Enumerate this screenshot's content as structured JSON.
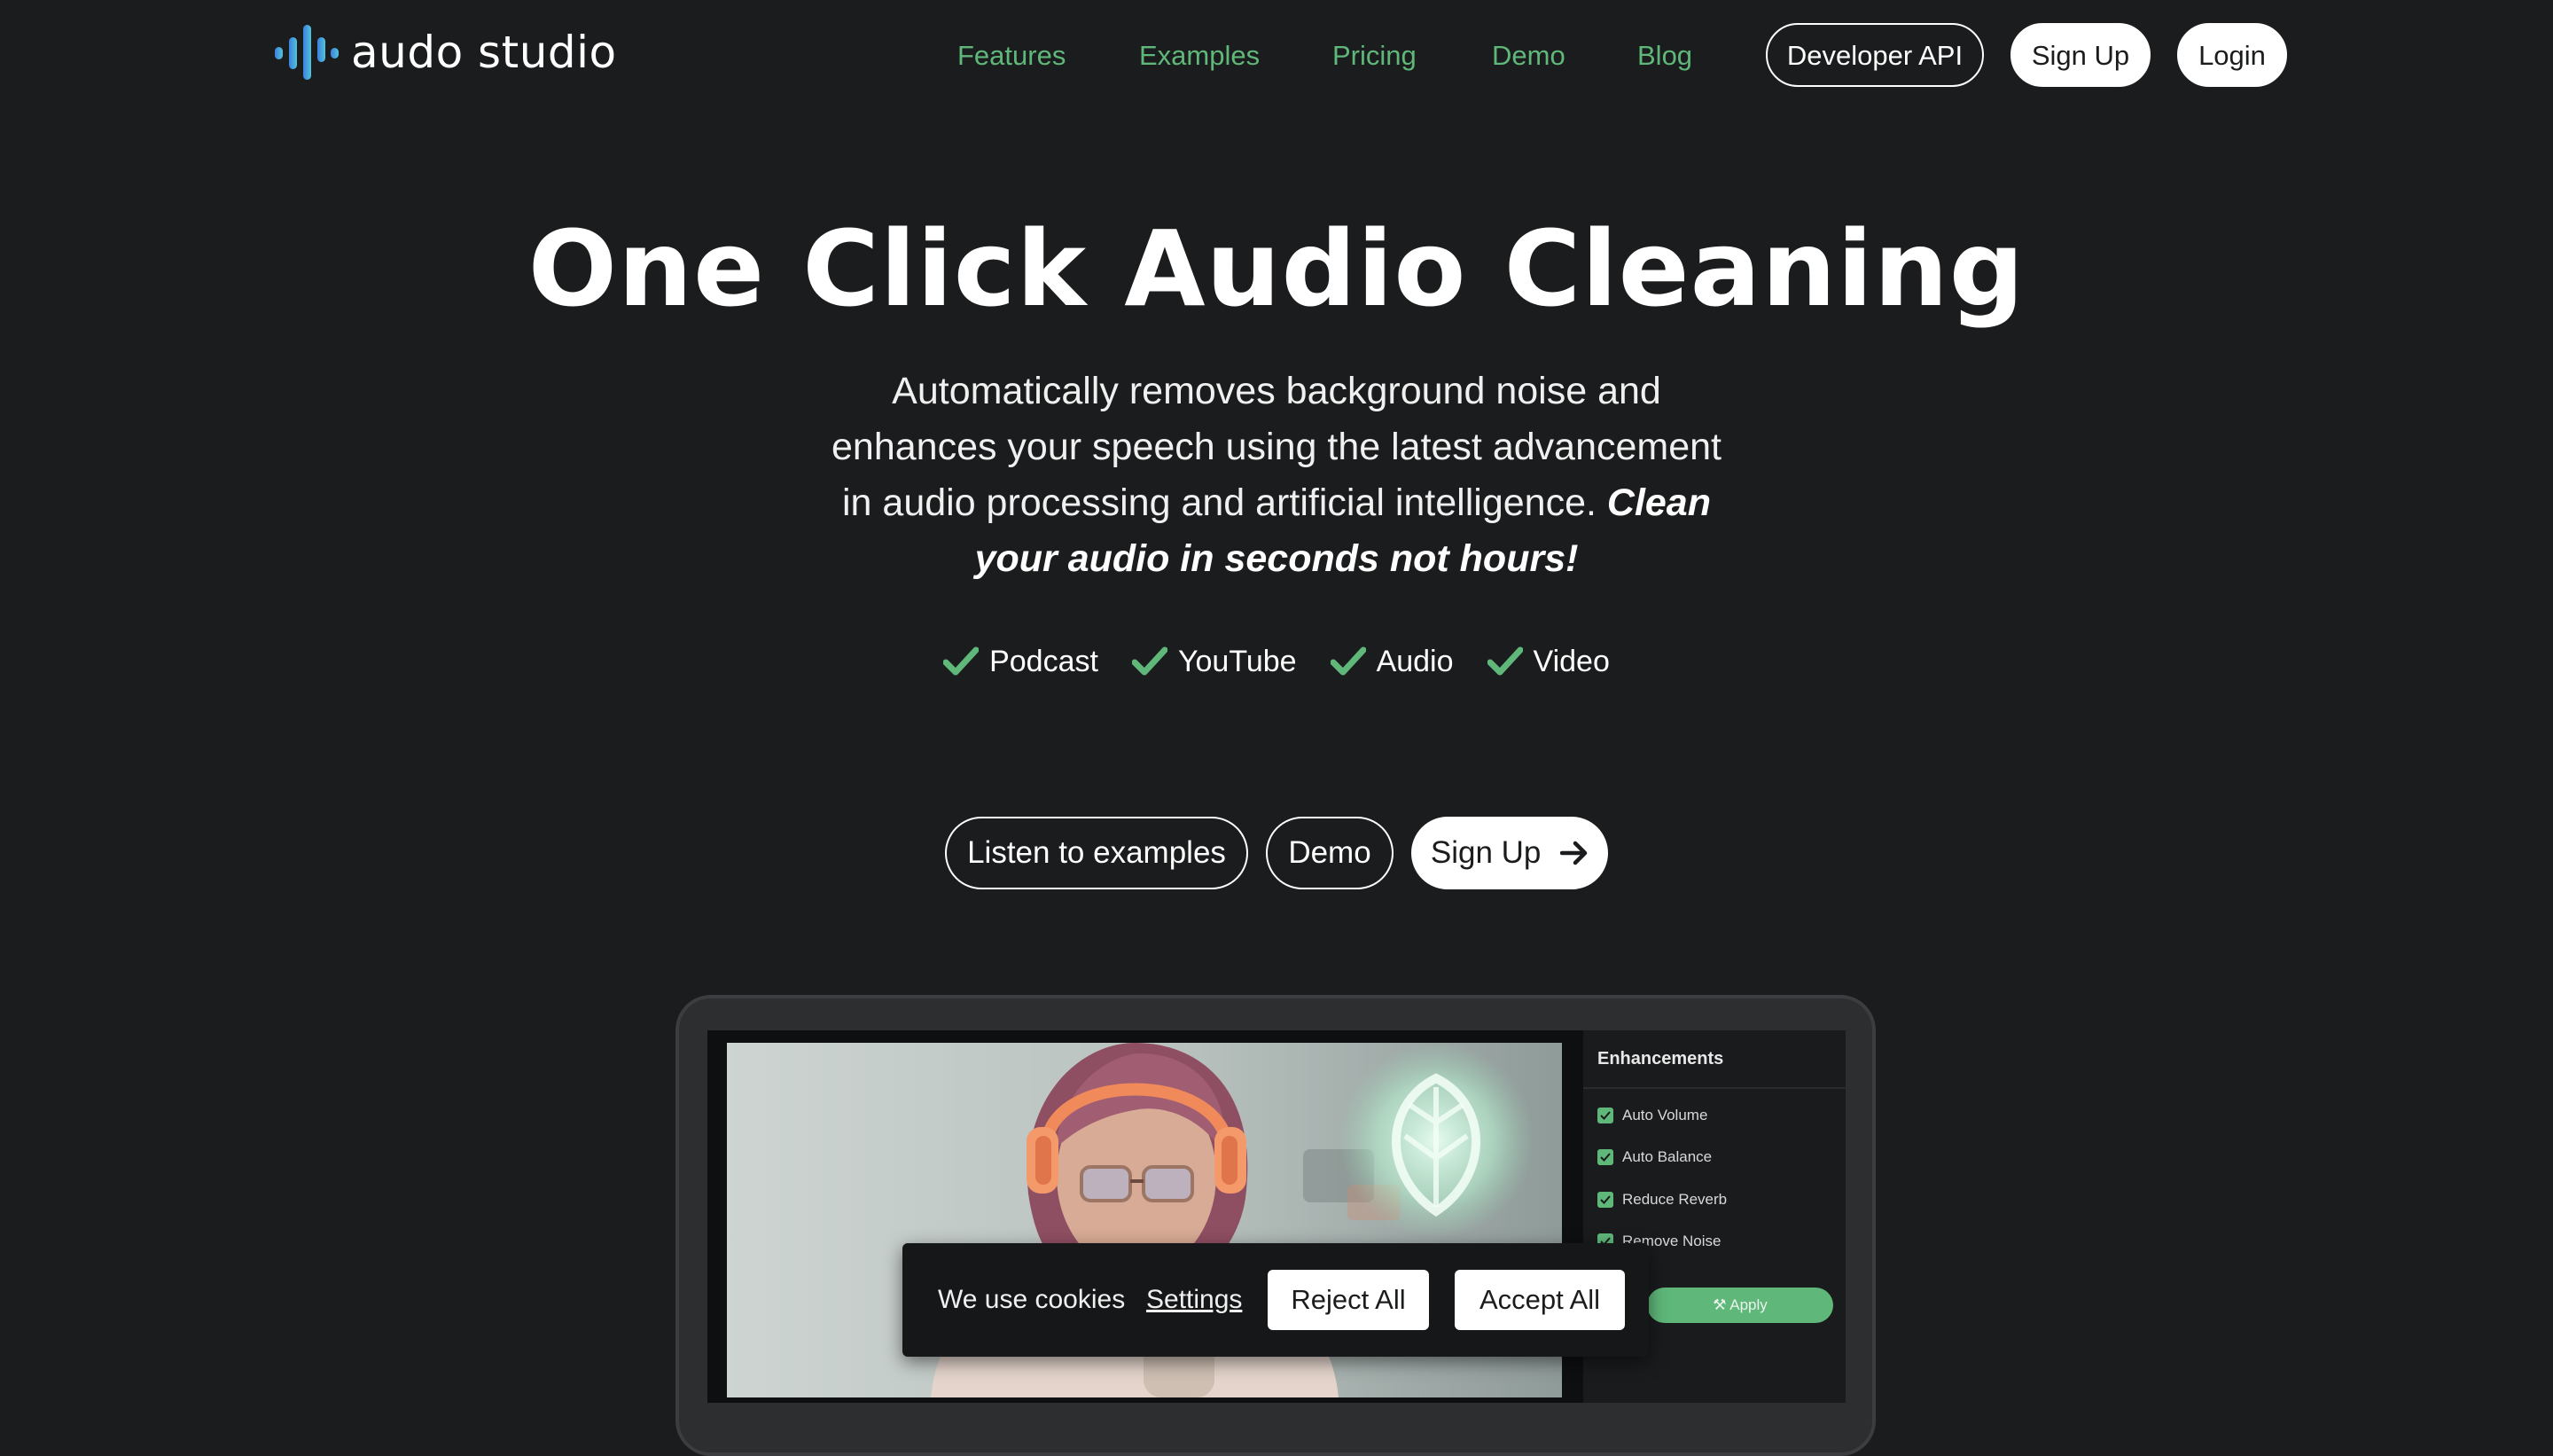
{
  "brand": {
    "name": "audo studio",
    "accent": "#5fb77a",
    "background": "#1b1c1d"
  },
  "nav": {
    "links": [
      "Features",
      "Examples",
      "Pricing",
      "Demo",
      "Blog"
    ],
    "developer_api": "Developer API",
    "sign_up": "Sign Up",
    "login": "Login"
  },
  "hero": {
    "title": "One Click Audio Cleaning",
    "subtitle": "Automatically removes background noise and enhances your speech using the latest advancement in audio processing and artificial intelligence.",
    "subtitle_emphasis": "Clean your audio in seconds not hours!",
    "checks": [
      "Podcast",
      "YouTube",
      "Audio",
      "Video"
    ],
    "cta": {
      "listen": "Listen to examples",
      "demo": "Demo",
      "sign_up": "Sign Up"
    }
  },
  "mockup": {
    "panel_title": "Enhancements",
    "enhancements": [
      "Auto Volume",
      "Auto Balance",
      "Reduce Reverb",
      "Remove Noise"
    ],
    "apply": "Apply"
  },
  "cookies": {
    "message": "We use cookies",
    "settings": "Settings",
    "reject": "Reject All",
    "accept": "Accept All"
  }
}
